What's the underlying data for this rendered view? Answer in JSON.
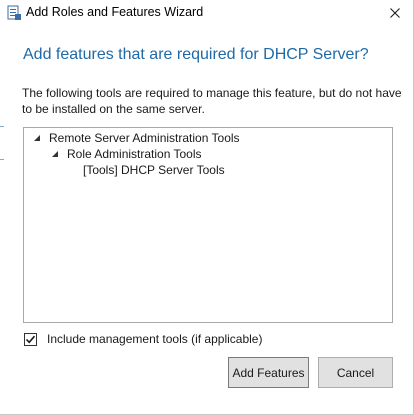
{
  "window": {
    "title": "Add Roles and Features Wizard"
  },
  "dialog": {
    "heading": "Add features that are required for DHCP Server?",
    "description": "The following tools are required to manage this feature, but do not have to be installed on the same server."
  },
  "tree": {
    "items": [
      {
        "label": "Remote Server Administration Tools",
        "level": 0,
        "expanded": true,
        "has_children": true
      },
      {
        "label": "Role Administration Tools",
        "level": 1,
        "expanded": true,
        "has_children": true
      },
      {
        "label": "[Tools] DHCP Server Tools",
        "level": 2,
        "expanded": false,
        "has_children": false
      }
    ]
  },
  "options": {
    "include_management_tools_label": "Include management tools (if applicable)",
    "include_management_tools_checked": true
  },
  "buttons": {
    "add_features_label": "Add Features",
    "cancel_label": "Cancel"
  },
  "colors": {
    "heading": "#1e6aa8",
    "button_face": "#e1e1e1",
    "border": "#a9a9a9"
  },
  "icons": {
    "app": "server-manager-icon",
    "close": "close-icon",
    "expanded": "triangle-expanded-icon",
    "check": "checkmark-icon"
  }
}
